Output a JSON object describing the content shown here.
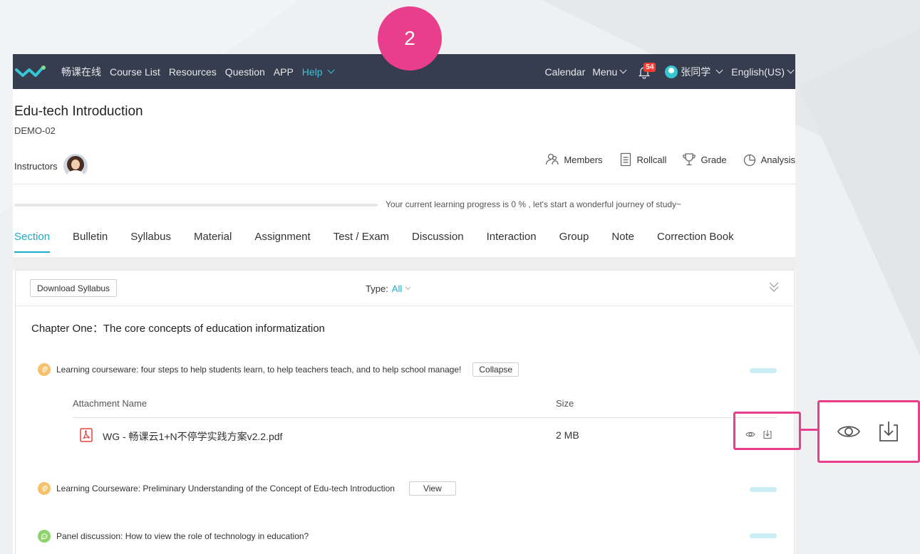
{
  "annotation": {
    "step_number": "2"
  },
  "nav": {
    "brand": "畅课在线",
    "items": [
      "Course List",
      "Resources",
      "Question",
      "APP"
    ],
    "help": "Help",
    "calendar": "Calendar",
    "menu": "Menu",
    "notification_count": "54",
    "user_name": "张同学",
    "language": "English(US)"
  },
  "course": {
    "title": "Edu-tech Introduction",
    "code": "DEMO-02",
    "instructors_label": "Instructors",
    "actions": {
      "members": "Members",
      "rollcall": "Rollcall",
      "grade": "Grade",
      "analysis": "Analysis"
    },
    "progress_percent": 0,
    "progress_text": "Your current learning progress is 0 % , let's start a wonderful journey of study~"
  },
  "tabs": [
    "Section",
    "Bulletin",
    "Syllabus",
    "Material",
    "Assignment",
    "Test / Exam",
    "Discussion",
    "Interaction",
    "Group",
    "Note",
    "Correction Book"
  ],
  "active_tab": "Section",
  "toolbar": {
    "download_syllabus": "Download Syllabus",
    "type_label": "Type:",
    "type_value": "All"
  },
  "chapter": {
    "title": "Chapter One：The core concepts of education informatization",
    "items": [
      {
        "title": "Learning courseware: four steps to help students learn, to help teachers teach, and to help school manage!",
        "button": "Collapse"
      },
      {
        "title": "Learning Courseware: Preliminary Understanding of the Concept of Edu-tech Introduction",
        "button": "View"
      },
      {
        "title": "Panel discussion: How to view the role of technology in education?"
      }
    ],
    "attachments": {
      "header_name": "Attachment Name",
      "header_size": "Size",
      "rows": [
        {
          "name": "WG - 畅课云1+N不停学实践方案v2.2.pdf",
          "size": "2 MB"
        }
      ]
    }
  },
  "colors": {
    "nav_bg": "#353d4e",
    "accent": "#1aaecc",
    "highlight": "#e83e8c"
  },
  "icons": [
    "logo-icon",
    "chevron-down-icon",
    "bell-icon",
    "avatar",
    "members-icon",
    "rollcall-icon",
    "grade-trophy-icon",
    "analysis-pie-icon",
    "expand-collapse-icon",
    "courseware-icon",
    "discussion-icon",
    "pdf-icon",
    "eye-icon",
    "download-icon"
  ]
}
